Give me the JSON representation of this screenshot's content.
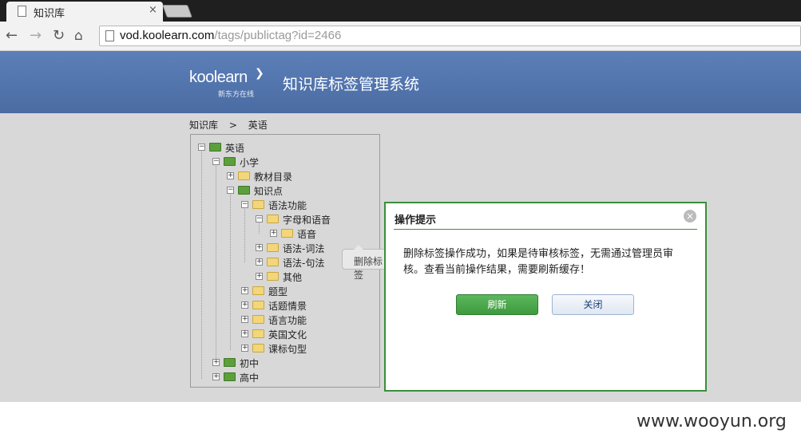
{
  "browser": {
    "tab_title": "知识库",
    "tab_close": "×",
    "url_host": "vod.koolearn.com",
    "url_path": "/tags/publictag?id=2466"
  },
  "header": {
    "logo_text": "koolearn",
    "logo_sub": "新东方在线",
    "system_title": "知识库标签管理系统"
  },
  "breadcrumb": [
    "知识库",
    ">",
    "英语"
  ],
  "tree": {
    "nodes": [
      {
        "label": "英语",
        "toggle": "−",
        "folder": "green"
      },
      {
        "label": "小学",
        "toggle": "−",
        "folder": "green"
      },
      {
        "label": "教材目录",
        "toggle": "+",
        "folder": "yellow"
      },
      {
        "label": "知识点",
        "toggle": "−",
        "folder": "green"
      },
      {
        "label": "语法功能",
        "toggle": "−",
        "folder": "yellow"
      },
      {
        "label": "字母和语音",
        "toggle": "−",
        "folder": "yellow"
      },
      {
        "label": "语音",
        "toggle": "+",
        "folder": "yellow"
      },
      {
        "label": "语法-词法",
        "toggle": "+",
        "folder": "yellow"
      },
      {
        "label": "语法-句法",
        "toggle": "+",
        "folder": "yellow"
      },
      {
        "label": "其他",
        "toggle": "+",
        "folder": "yellow"
      },
      {
        "label": "题型",
        "toggle": "+",
        "folder": "yellow"
      },
      {
        "label": "话题情景",
        "toggle": "+",
        "folder": "yellow"
      },
      {
        "label": "语言功能",
        "toggle": "+",
        "folder": "yellow"
      },
      {
        "label": "英国文化",
        "toggle": "+",
        "folder": "yellow"
      },
      {
        "label": "课标句型",
        "toggle": "+",
        "folder": "yellow"
      },
      {
        "label": "初中",
        "toggle": "+",
        "folder": "green"
      },
      {
        "label": "高中",
        "toggle": "+",
        "folder": "green"
      }
    ]
  },
  "tooltip": "删除标签",
  "dialog": {
    "title": "操作提示",
    "close": "×",
    "message": "删除标签操作成功，如果是待审核标签，无需通过管理员审核。查看当前操作结果，需要刷新缓存！",
    "refresh_label": "刷新",
    "close_label": "关闭"
  },
  "watermark": "www.wooyun.org"
}
